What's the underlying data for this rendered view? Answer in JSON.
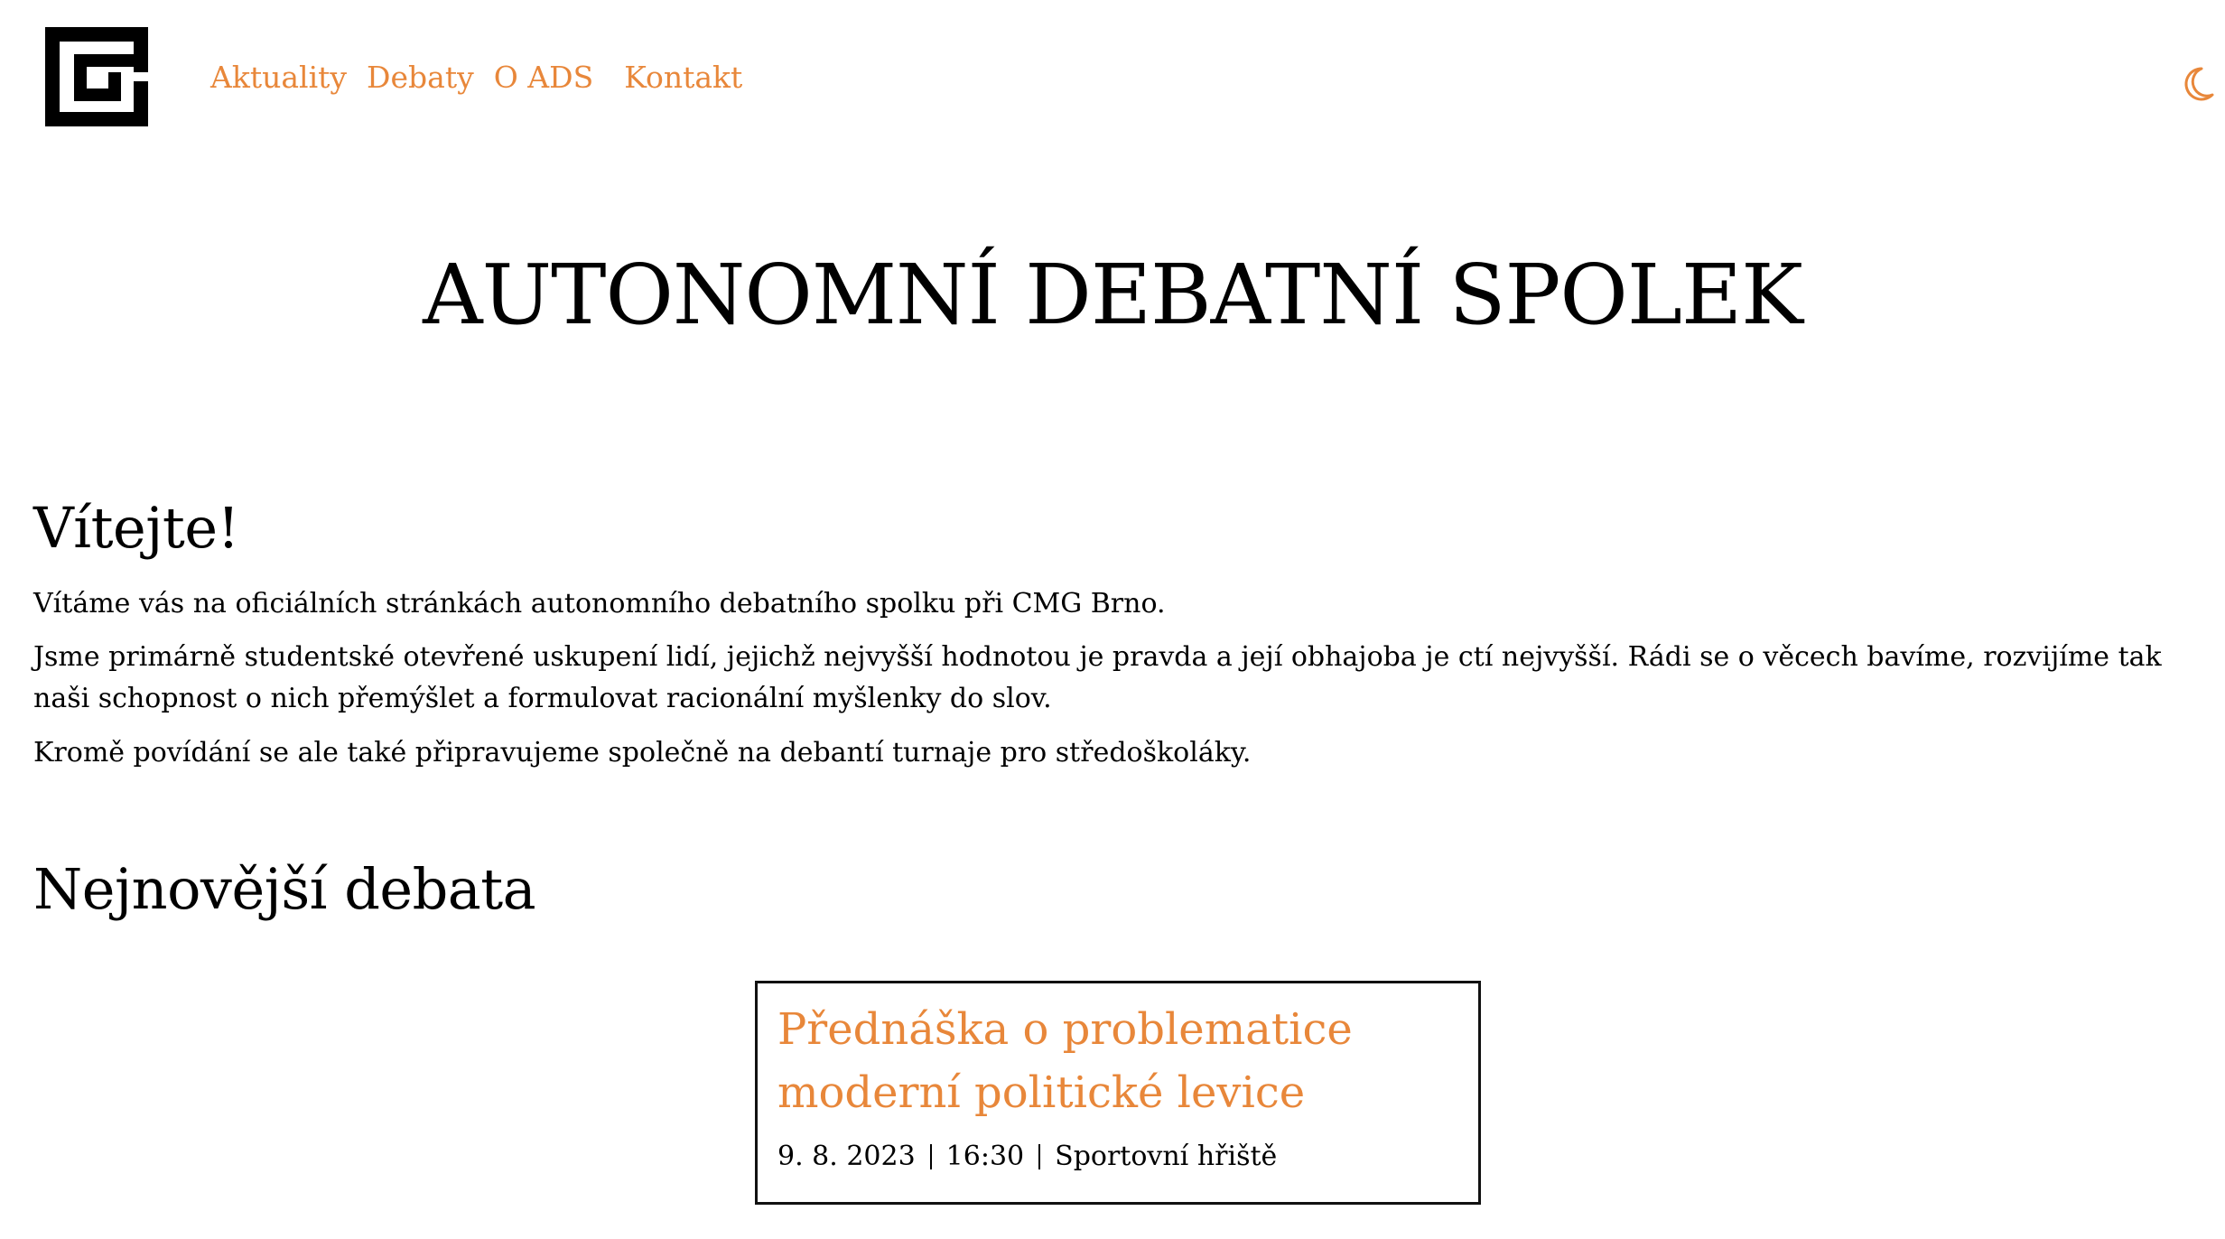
{
  "header": {
    "logo_icon": "meander-logo-icon",
    "nav": [
      "Aktuality",
      "Debaty",
      "O ADS",
      "Kontakt"
    ],
    "theme_toggle_icon": "moon-icon",
    "accent_color": "#e8873a"
  },
  "hero": {
    "title": "AUTONOMNÍ DEBATNÍ SPOLEK"
  },
  "welcome": {
    "title": "Vítejte!",
    "paragraphs": [
      "Vítáme vás na oficiálních stránkách autonomního debatního spolku při CMG Brno.",
      "Jsme primárně studentské otevřené uskupení lidí, jejichž nejvyšší hodnotou je pravda a její obhajoba je ctí nejvyšší. Rádi se o věcech bavíme, rozvijíme tak naši schopnost o nich přemýšlet a formulovat racionální myšlenky do slov.",
      "Kromě povídání se ale také připravujeme společně na debantí turnaje pro středoškoláky."
    ]
  },
  "latest": {
    "title": "Nejnovější debata",
    "card": {
      "title": "Přednáška o problematice moderní politické levice",
      "date": "9. 8. 2023",
      "time": "16:30",
      "place": "Sportovní hřiště"
    }
  }
}
